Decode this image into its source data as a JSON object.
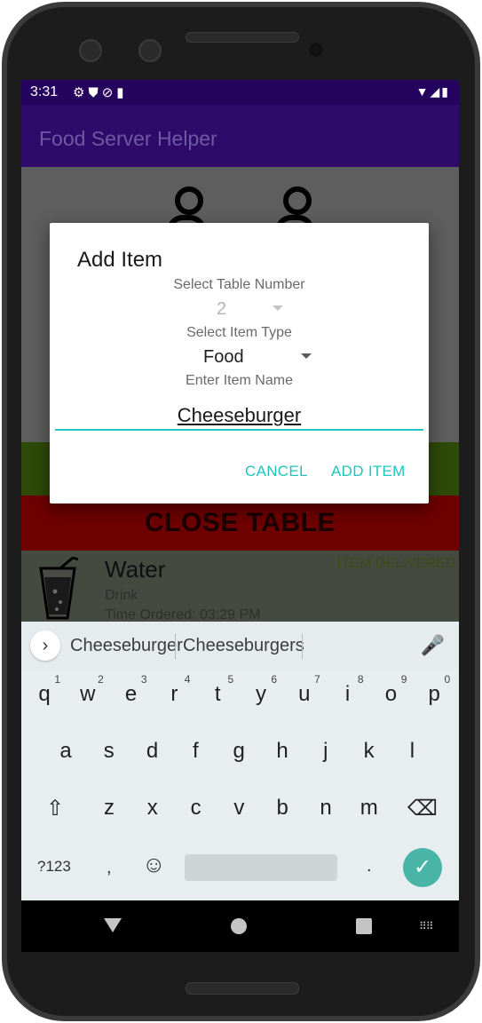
{
  "status_bar": {
    "time": "3:31",
    "left_icons": [
      "gear-icon",
      "shield-icon",
      "sync-icon",
      "sd-card-icon"
    ],
    "right_icons": [
      "wifi-icon",
      "signal-icon",
      "battery-icon"
    ]
  },
  "app": {
    "title": "Food Server Helper",
    "close_table_label": "CLOSE TABLE"
  },
  "order_item": {
    "name": "Water",
    "type": "Drink",
    "time": "Time Ordered: 03:29 PM",
    "status": "ITEM DELIVERED",
    "icon": "glass-icon"
  },
  "dialog": {
    "title": "Add Item",
    "table_label": "Select Table Number",
    "table_value": "2",
    "type_label": "Select Item Type",
    "type_value": "Food",
    "name_label": "Enter Item Name",
    "name_value": "Cheeseburger",
    "cancel_label": "CANCEL",
    "add_label": "ADD ITEM"
  },
  "keyboard": {
    "suggestions": [
      "Cheeseburger",
      "Cheeseburgers"
    ],
    "row1": [
      "q",
      "w",
      "e",
      "r",
      "t",
      "y",
      "u",
      "i",
      "o",
      "p"
    ],
    "row1_nums": [
      "1",
      "2",
      "3",
      "4",
      "5",
      "6",
      "7",
      "8",
      "9",
      "0"
    ],
    "row2": [
      "a",
      "s",
      "d",
      "f",
      "g",
      "h",
      "j",
      "k",
      "l"
    ],
    "row3": [
      "z",
      "x",
      "c",
      "v",
      "b",
      "n",
      "m"
    ],
    "symbols_label": "?123",
    "comma": ",",
    "period": ".",
    "emoji": "☺",
    "shift": "⇧",
    "backspace": "⌫",
    "enter": "✓",
    "mic": "🎤"
  },
  "colors": {
    "status_bar": "#24045e",
    "app_bar": "#2e0a6b",
    "accent": "#20c4bd",
    "close_table": "#6e0000",
    "enter_key": "#48b5a7"
  }
}
